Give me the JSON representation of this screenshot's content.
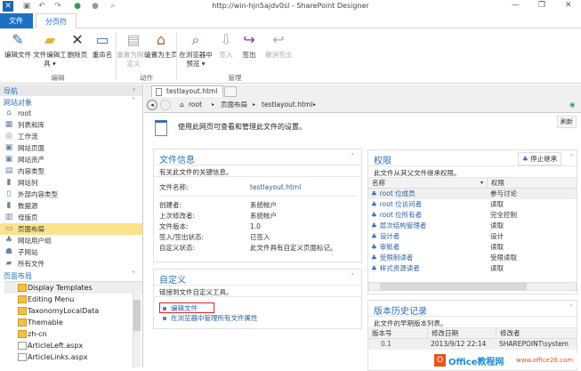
{
  "window": {
    "title": "http://win-hjn5ajdv0sl - SharePoint Designer"
  },
  "ribbon_tabs": [
    {
      "label": "文件"
    },
    {
      "label": "分页符"
    }
  ],
  "ribbon": {
    "buttons": [
      {
        "label": "编辑文件",
        "icon": "edit-file-icon"
      },
      {
        "label": "文件编辑工具 ▾",
        "icon": "folder-icon"
      },
      {
        "label": "删除页",
        "icon": "delete-icon"
      },
      {
        "label": "重命名",
        "icon": "rename-icon"
      },
      {
        "label": "重置为网站定义",
        "icon": "reset-icon"
      },
      {
        "label": "设置为主页",
        "icon": "home-page-icon"
      },
      {
        "label": "在浏览器中预览 ▾",
        "icon": "preview-icon"
      },
      {
        "label": "签入",
        "icon": "check-in-icon"
      },
      {
        "label": "签出",
        "icon": "check-out-icon"
      },
      {
        "label": "撤消签出",
        "icon": "undo-checkout-icon"
      }
    ],
    "groups": [
      "编辑",
      "动作",
      "管理"
    ]
  },
  "nav": {
    "header": "导航",
    "site_objects_title": "网站对象",
    "items": [
      "root",
      "列表和库",
      "工作流",
      "网站页面",
      "网站资产",
      "内容类型",
      "网站列",
      "外部内容类型",
      "数据源",
      "母版页",
      "页面布局",
      "网站用户组",
      "子网站",
      "所有文件"
    ],
    "selected": "页面布局",
    "page_layouts_title": "页面布局",
    "files": [
      {
        "name": "Display Templates",
        "type": "folder"
      },
      {
        "name": "Editing Menu",
        "type": "folder"
      },
      {
        "name": "TaxonomyLocalData",
        "type": "folder"
      },
      {
        "name": "Themable",
        "type": "folder"
      },
      {
        "name": "zh-cn",
        "type": "folder"
      },
      {
        "name": "ArticleLeft.aspx",
        "type": "file"
      },
      {
        "name": "ArticleLinks.aspx",
        "type": "file"
      }
    ]
  },
  "doc_tab": {
    "label": "testlayout.html"
  },
  "breadcrumb": [
    "root",
    "页面布局",
    "testlayout.html"
  ],
  "refresh_label": "刷新",
  "intro": "使用此网页可查看和管理此文件的设置。",
  "file_info": {
    "title": "文件信息",
    "desc": "有关此文件的关键信息。",
    "name_label": "文件名称:",
    "name_value": "testlayout.html",
    "fields": [
      {
        "label": "创建者:",
        "value": "系统帐户"
      },
      {
        "label": "上次修改者:",
        "value": "系统帐户"
      },
      {
        "label": "文件版本:",
        "value": "1.0"
      },
      {
        "label": "签入/签出状态:",
        "value": "已签入"
      },
      {
        "label": "自定义状态:",
        "value": "此文件具有自定义页面标记。"
      }
    ]
  },
  "customize": {
    "title": "自定义",
    "desc": "链接到文件自定义工具。",
    "links": [
      "编辑文件",
      "在浏览器中管理所有文件属性"
    ]
  },
  "permissions": {
    "title": "权限",
    "stop_inherit": "停止继承",
    "desc": "此文件从其父文件继承权限。",
    "columns": [
      "名称",
      "权限"
    ],
    "rows": [
      {
        "name": "root 位成员",
        "perm": "参与讨论"
      },
      {
        "name": "root 位访问者",
        "perm": "读取"
      },
      {
        "name": "root 位所有者",
        "perm": "完全控制"
      },
      {
        "name": "层次结构管理者",
        "perm": "读取"
      },
      {
        "name": "设计者",
        "perm": "设计"
      },
      {
        "name": "审批者",
        "perm": "读取"
      },
      {
        "name": "受限制读者",
        "perm": "受限读取"
      },
      {
        "name": "样式资源读者",
        "perm": "读取"
      }
    ]
  },
  "versions": {
    "title": "版本历史记录",
    "desc": "此文件的早期版本列表。",
    "columns": [
      "版本号",
      "修改日期",
      "修改者"
    ],
    "rows": [
      {
        "version": "0.1",
        "date": "2013/9/12 22:14",
        "by": "SHAREPOINT\\system"
      }
    ]
  },
  "watermark": {
    "text": "Office教程网",
    "url": "www.office26.com"
  }
}
